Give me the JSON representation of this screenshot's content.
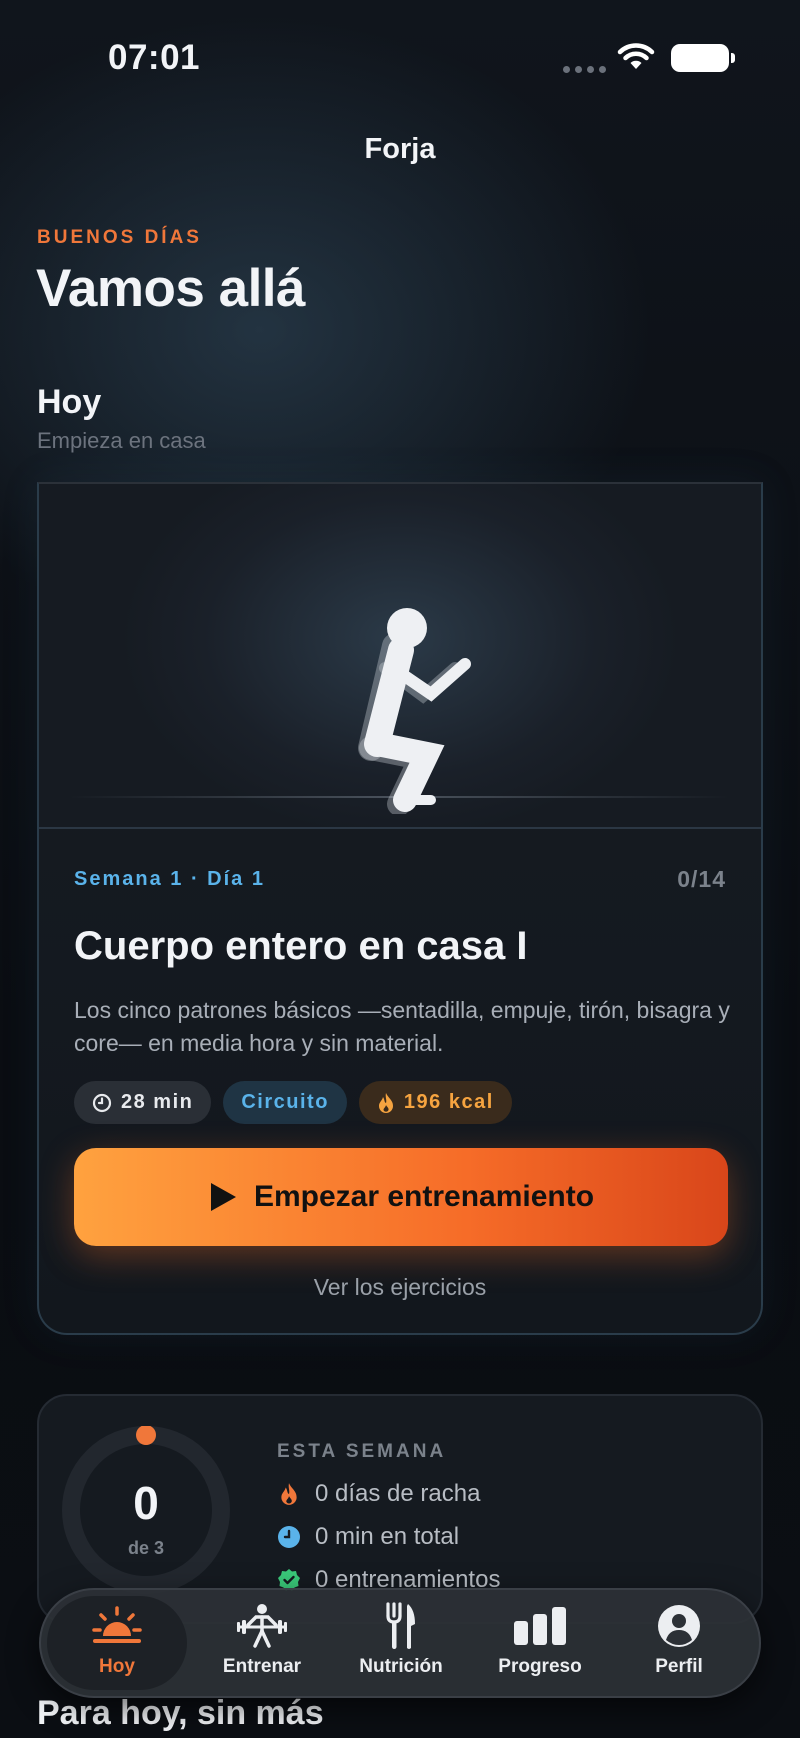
{
  "status_bar": {
    "time": "07:01"
  },
  "app": {
    "title": "Forja"
  },
  "greeting": {
    "eyebrow": "BUENOS DÍAS",
    "title": "Vamos allá"
  },
  "today": {
    "title": "Hoy",
    "subtitle": "Empieza en casa"
  },
  "workout": {
    "meta": "Semana 1 · Día 1",
    "count": "0/14",
    "title": "Cuerpo entero en casa I",
    "description": "Los cinco patrones básicos —sentadilla, empuje, tirón, bisagra y core— en media hora y sin material.",
    "chips": {
      "duration": "28 min",
      "type": "Circuito",
      "calories": "196 kcal"
    },
    "cta_label": "Empezar entrenamiento",
    "secondary_link": "Ver los ejercicios",
    "illustration": "squat-figure"
  },
  "week": {
    "eyebrow": "ESTA SEMANA",
    "ring_value": "0",
    "ring_goal": "de 3",
    "ring_progress": 0,
    "stats": [
      {
        "icon": "flame-icon",
        "label": "0 días de racha"
      },
      {
        "icon": "clock-icon",
        "label": "0 min en total"
      },
      {
        "icon": "check-badge-icon",
        "label": "0 entrenamientos"
      }
    ]
  },
  "tabs": [
    {
      "label": "Hoy",
      "icon": "sunrise-icon",
      "active": true
    },
    {
      "label": "Entrenar",
      "icon": "weightlifter-icon",
      "active": false
    },
    {
      "label": "Nutrición",
      "icon": "fork-knife-icon",
      "active": false
    },
    {
      "label": "Progreso",
      "icon": "bar-chart-icon",
      "active": false
    },
    {
      "label": "Perfil",
      "icon": "person-icon",
      "active": false
    }
  ],
  "next_section": {
    "title": "Para hoy, sin más"
  },
  "colors": {
    "accent": "#f0773a",
    "info": "#5ab3ea",
    "calories": "#f6a440",
    "success": "#3ac97a"
  }
}
